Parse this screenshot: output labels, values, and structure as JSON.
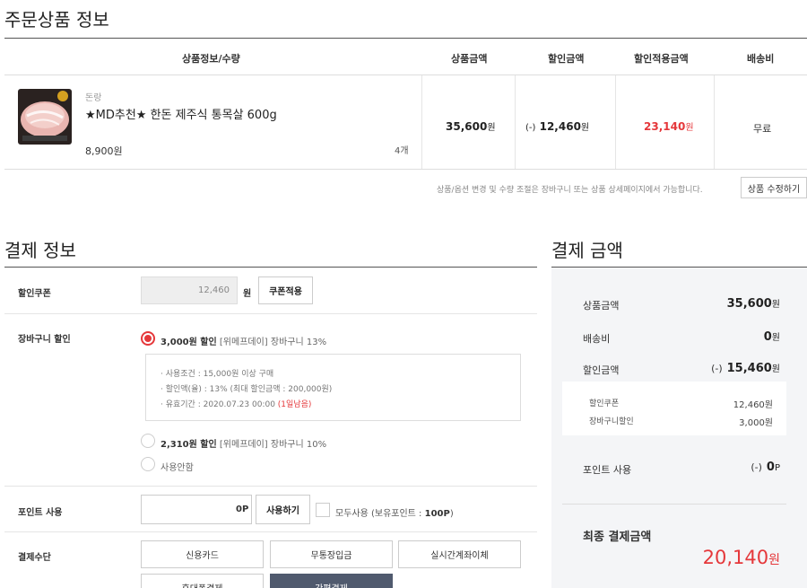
{
  "order": {
    "title": "주문상품 정보",
    "headers": {
      "product": "상품정보/수량",
      "price": "상품금액",
      "discount": "할인금액",
      "applied": "할인적용금액",
      "shipping": "배송비"
    },
    "item": {
      "category": "돈랑",
      "name": "★MD추천★ 한돈 제주식 통목살 600g",
      "unit_price": "8,900원",
      "qty": "4개",
      "price": "35,600",
      "discount_prefix": "(-)",
      "discount": "12,460",
      "applied": "23,140",
      "won": "원",
      "shipping": "무료"
    },
    "notice": "상품/옵션 변경 및 수량 조절은 장바구니 또는 상품 상세페이지에서 가능합니다.",
    "edit_button": "상품 수정하기"
  },
  "payment_info": {
    "title": "결제 정보",
    "coupon": {
      "label": "할인쿠폰",
      "value": "12,460",
      "unit": "원",
      "button": "쿠폰적용"
    },
    "cart_discount": {
      "label": "장바구니 할인",
      "option1_bold": "3,000원 할인",
      "option1_rest": " [위메프데이] 장바구니 13%",
      "cond1": "· 사용조건 : 15,000원 이상 구매",
      "cond2": "· 할인액(율) : 13% (최대 할인금액 : 200,000원)",
      "cond3": "· 유효기간 : 2020.07.23 00:00 ",
      "cond3_red": "(1일남음)",
      "option2_bold": "2,310원 할인",
      "option2_rest": " [위메프데이] 장바구니 10%",
      "option3": "사용안함"
    },
    "points": {
      "label": "포인트 사용",
      "value": "0",
      "unit": "P",
      "button": "사용하기",
      "use_all": "모두사용 (보유포인트 : ",
      "use_all_points": "100P",
      "use_all_end": ")"
    },
    "method": {
      "label": "결제수단",
      "buttons": [
        "신용카드",
        "무통장입금",
        "실시간계좌이체",
        "휴대폰결제",
        "간편결제"
      ]
    }
  },
  "amount": {
    "title": "결제 금액",
    "product_label": "상품금액",
    "product_value": "35,600",
    "shipping_label": "배송비",
    "shipping_value": "0",
    "discount_label": "할인금액",
    "discount_prefix": "(-)",
    "discount_value": "15,460",
    "won": "원",
    "coupon_label": "할인쿠폰",
    "coupon_value": "12,460원",
    "cart_label": "장바구니할인",
    "cart_value": "3,000원",
    "points_label": "포인트 사용",
    "points_prefix": "(-)",
    "points_value": "0",
    "points_unit": "P",
    "final_label": "최종 결제금액",
    "final_value": "20,140",
    "final_won": "원"
  },
  "colors": {
    "accent": "#e5383b",
    "active_button": "#505a6e",
    "panel": "#f4f5f7"
  }
}
